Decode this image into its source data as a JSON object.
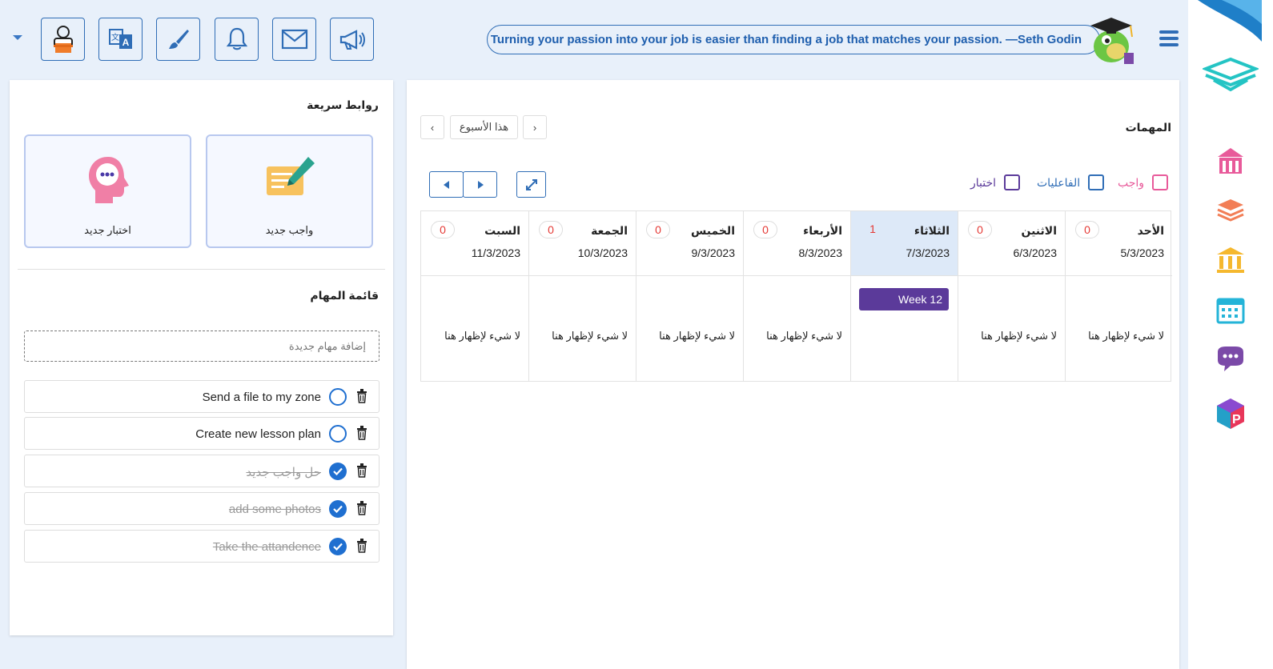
{
  "topbar": {
    "quote": "Turning your passion into your job is easier than finding a job that matches your passion. —Seth Godin",
    "tools": [
      "teacher-icon",
      "translate-icon",
      "brush-icon",
      "bell-icon",
      "mail-icon",
      "megaphone-icon"
    ]
  },
  "quick_links": {
    "title": "روابط سريعة",
    "new_homework": "واجب جديد",
    "new_exam": "اختبار جديد"
  },
  "task_list": {
    "title": "قائمة المهام",
    "add_placeholder": "إضافة مهام جديدة",
    "tasks": [
      {
        "label": "Send a file to my zone",
        "done": false
      },
      {
        "label": "Create new lesson plan",
        "done": false
      },
      {
        "label": "حل واجب جديد",
        "done": true
      },
      {
        "label": "add some photos",
        "done": true
      },
      {
        "label": "Take the attandence",
        "done": true
      }
    ]
  },
  "tasks_panel": {
    "title": "المهمات",
    "this_week": "هذا الأسبوع",
    "filters": {
      "homework": "واجب",
      "activities": "الفاعليات",
      "exam": "اختبار"
    },
    "colors": {
      "homework": "#e85a9a",
      "activities": "#2f6db6",
      "exam": "#5b3a9a",
      "count": "#e53935"
    },
    "empty_text": "لا شيء لإظهار هنا",
    "days": [
      {
        "name": "الأحد",
        "date": "5/3/2023",
        "count": "0"
      },
      {
        "name": "الاثنين",
        "date": "6/3/2023",
        "count": "0"
      },
      {
        "name": "الثلاثاء",
        "date": "7/3/2023",
        "count": "1",
        "event": "Week 12"
      },
      {
        "name": "الأربعاء",
        "date": "8/3/2023",
        "count": "0"
      },
      {
        "name": "الخميس",
        "date": "9/3/2023",
        "count": "0"
      },
      {
        "name": "الجمعة",
        "date": "10/3/2023",
        "count": "0"
      },
      {
        "name": "السبت",
        "date": "11/3/2023",
        "count": "0"
      }
    ]
  }
}
